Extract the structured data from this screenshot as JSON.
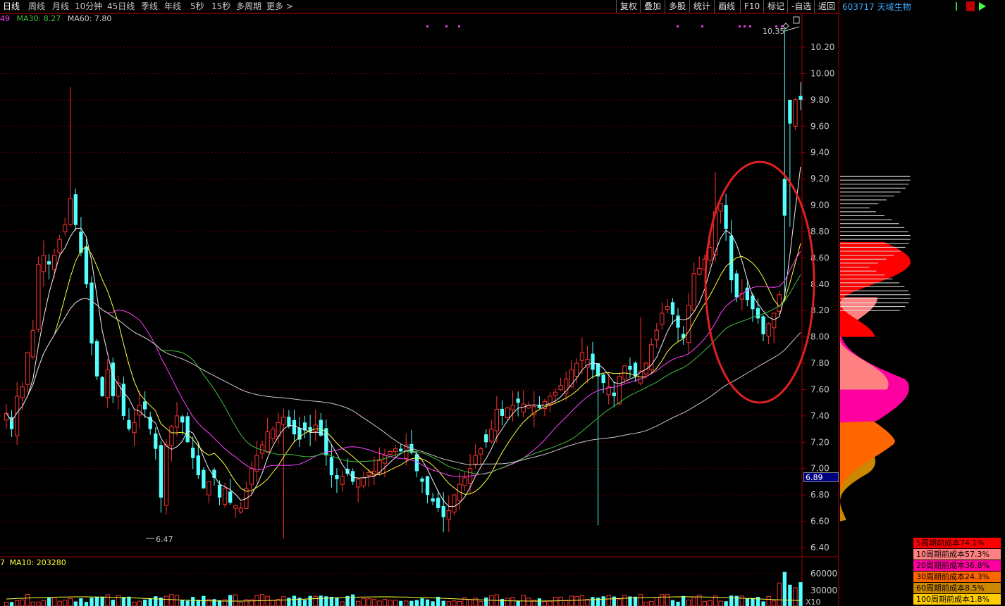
{
  "toolbar": {
    "periods": [
      "日线",
      "周线",
      "月线",
      "10分钟",
      "45日线",
      "季线",
      "年线",
      "5秒",
      "15秒",
      "多周期",
      "更多 >"
    ],
    "active": "日线",
    "buttons": [
      "复权",
      "叠加",
      "多股",
      "统计",
      "画线",
      "F10",
      "标记",
      "-自选",
      "返回"
    ]
  },
  "stock": {
    "code": "603717",
    "name": "天域生物",
    "title": "603717 天域生物"
  },
  "indicators": {
    "ma_prefix": "49",
    "ma30": "MA30: 8.27",
    "ma60": "MA60: 7.80",
    "vol_prefix": "7",
    "vol_ma10": "MA10: 203280"
  },
  "price_axis": {
    "labels": [
      "10.20",
      "10.00",
      "9.80",
      "9.60",
      "9.40",
      "9.20",
      "9.00",
      "8.80",
      "8.60",
      "8.40",
      "8.20",
      "8.00",
      "7.80",
      "7.60",
      "7.40",
      "7.20",
      "7.00",
      "6.80",
      "6.60",
      "6.40"
    ],
    "values": [
      10.2,
      10.0,
      9.8,
      9.6,
      9.4,
      9.2,
      9.0,
      8.8,
      8.6,
      8.4,
      8.2,
      8.0,
      7.8,
      7.6,
      7.4,
      7.2,
      7.0,
      6.8,
      6.6,
      6.4
    ]
  },
  "annotations": {
    "high": "10.35",
    "low": "6.47",
    "current_price": "6.89"
  },
  "volume_axis": {
    "labels": [
      "60000",
      "30000"
    ],
    "unit": "X10"
  },
  "chip_legend": [
    {
      "label": "5周期前成本74.1%",
      "color": "#ff0000"
    },
    {
      "label": "10周期前成本57.3%",
      "color": "#ff8080"
    },
    {
      "label": "20周期前成本36.8%",
      "color": "#ff00a0"
    },
    {
      "label": "30周期前成本24.3%",
      "color": "#ff6600"
    },
    {
      "label": "60周期前成本8.5%",
      "color": "#cc8800"
    },
    {
      "label": "100周期前成本1.8%",
      "color": "#ffcc00"
    }
  ],
  "colors": {
    "up": "#ff3232",
    "down": "#54ffff",
    "ma_white": "#f0f0f0",
    "ma_yellow": "#ffff40",
    "ma_magenta": "#ff40ff",
    "ma_green": "#40c040",
    "ma_grey": "#c8c8c8",
    "circle": "#e02020"
  },
  "chart_data": {
    "type": "candlestick",
    "count": 150,
    "closes": [
      7.42,
      7.3,
      7.55,
      7.62,
      7.88,
      8.05,
      8.55,
      8.62,
      8.55,
      8.62,
      8.74,
      8.85,
      9.05,
      8.85,
      8.64,
      8.4,
      7.95,
      7.7,
      7.55,
      7.75,
      7.55,
      7.65,
      7.4,
      7.3,
      7.35,
      7.48,
      7.45,
      7.3,
      7.15,
      6.78,
      7.18,
      7.32,
      7.4,
      7.35,
      7.2,
      7.08,
      6.95,
      6.85,
      6.9,
      6.93,
      6.78,
      6.85,
      6.74,
      6.72,
      6.7,
      6.85,
      7.0,
      7.1,
      7.18,
      7.28,
      7.3,
      7.35,
      7.39,
      7.32,
      7.26,
      7.22,
      7.29,
      7.28,
      7.33,
      7.25,
      7.1,
      6.95,
      6.92,
      6.94,
      6.96,
      6.9,
      6.92,
      6.93,
      6.97,
      6.98,
      7.06,
      7.1,
      7.13,
      7.15,
      7.13,
      7.18,
      7.12,
      6.98,
      6.9,
      6.8,
      6.75,
      6.7,
      6.63,
      6.68,
      6.8,
      6.88,
      6.93,
      7.0,
      7.1,
      7.15,
      7.2,
      7.3,
      7.45,
      7.4,
      7.46,
      7.48,
      7.5,
      7.49,
      7.48,
      7.47,
      7.46,
      7.51,
      7.55,
      7.58,
      7.63,
      7.68,
      7.75,
      7.8,
      7.88,
      7.83,
      7.75,
      7.7,
      7.65,
      7.62,
      7.55,
      7.7,
      7.78,
      7.75,
      7.7,
      7.74,
      7.8,
      7.94,
      8.05,
      8.18,
      8.23,
      8.17,
      8.07,
      7.99,
      8.24,
      8.48,
      8.52,
      8.59,
      8.68,
      8.95,
      9.01,
      8.82,
      8.43,
      8.3,
      8.33,
      8.28,
      8.21,
      8.14,
      8.02,
      8.1,
      8.18,
      8.32,
      8.92,
      9.62,
      9.8,
      9.8
    ],
    "high_value": 10.35,
    "low_value": 6.47,
    "ma_lines": [
      "MA5",
      "MA10",
      "MA20",
      "MA30",
      "MA60"
    ]
  }
}
